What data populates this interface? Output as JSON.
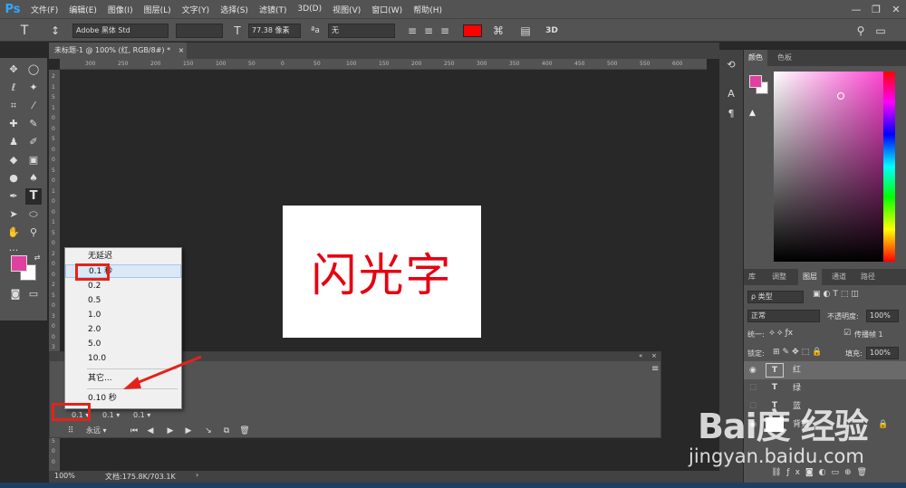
{
  "app": {
    "logo": "Ps"
  },
  "menu": [
    "文件(F)",
    "编辑(E)",
    "图像(I)",
    "图层(L)",
    "文字(Y)",
    "选择(S)",
    "滤镜(T)",
    "3D(D)",
    "视图(V)",
    "窗口(W)",
    "帮助(H)"
  ],
  "window_controls": {
    "minimize": "—",
    "restore": "❐",
    "close": "✕"
  },
  "options": {
    "tool_glyph": "T",
    "font_family": "Adobe 黑体 Std",
    "font_size": "77.38 像素",
    "aa_label": "ªa",
    "aa_mode": "无",
    "text_color": "#ff0000",
    "threed": "3D"
  },
  "document": {
    "tab_title": "未标题-1 @ 100% (红, RGB/8#) *",
    "ruler_h": [
      "300",
      "250",
      "200",
      "150",
      "100",
      "50",
      "0",
      "50",
      "100",
      "150",
      "200",
      "250",
      "300",
      "350",
      "400",
      "450",
      "500",
      "550",
      "600"
    ],
    "ruler_v": [
      "2",
      "1",
      "5",
      "1",
      "0",
      "0",
      "5",
      "0",
      "0",
      "5",
      "0",
      "1",
      "0",
      "0",
      "1",
      "5",
      "0",
      "2",
      "0",
      "0",
      "2",
      "5",
      "0",
      "3",
      "0",
      "0",
      "3",
      "5",
      "0",
      "4",
      "0",
      "0",
      "4",
      "5",
      "0",
      "5",
      "0",
      "0"
    ],
    "art_text": "闪光字",
    "art_text_color": "#e60012"
  },
  "status": {
    "zoom": "100%",
    "doc_info": "文档:175.8K/703.1K",
    "arrow": "›"
  },
  "timeline": {
    "frames": [
      {
        "delay": "0.1"
      },
      {
        "delay": "0.1"
      },
      {
        "delay": "0.1"
      }
    ],
    "loop": "永远",
    "menu_icon": "≡"
  },
  "delay_popup": {
    "items": [
      "无延迟",
      "0.1 秒",
      "0.2",
      "0.5",
      "1.0",
      "2.0",
      "5.0",
      "10.0"
    ],
    "other": "其它...",
    "current": "0.10 秒"
  },
  "panels": {
    "color_tabs": [
      "颜色",
      "色板"
    ],
    "layer_tabs": [
      "库",
      "调整",
      "图层",
      "通道",
      "路径"
    ],
    "filter_label": "ρ 类型",
    "blend_mode": "正常",
    "opacity_label": "不透明度:",
    "opacity_value": "100%",
    "unify_label": "统一:",
    "propagate_label": "传播帧 1",
    "lock_label": "锁定:",
    "fill_label": "填充:",
    "fill_value": "100%",
    "layers": [
      {
        "name": "红",
        "kind": "T"
      },
      {
        "name": "绿",
        "kind": "T"
      },
      {
        "name": "蓝",
        "kind": "T"
      },
      {
        "name": "背景",
        "kind": "bg"
      }
    ],
    "foreground_color": "#e040a0",
    "background_color": "#ffffff"
  },
  "watermark": {
    "logo": "Bai度 经验",
    "url": "jingyan.baidu.com"
  }
}
